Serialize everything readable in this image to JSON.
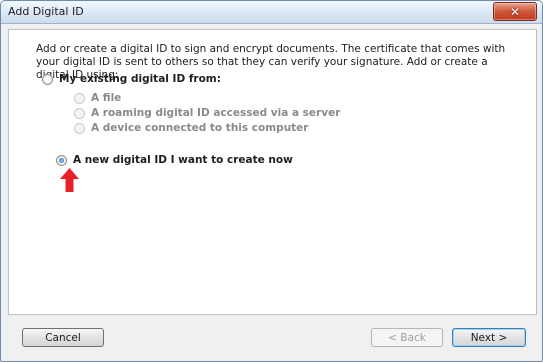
{
  "window": {
    "title": "Add Digital ID",
    "close_symbol": "✕"
  },
  "intro_text": "Add or create a digital ID to sign and encrypt documents. The certificate that comes with your digital ID is sent to others so that they can verify your signature. Add or create a digital ID using:",
  "options": {
    "existing": {
      "label": "My existing digital ID from:",
      "checked": false
    },
    "sub_options": [
      {
        "label": "A file",
        "enabled": false
      },
      {
        "label": "A roaming digital ID accessed via a server",
        "enabled": false
      },
      {
        "label": "A device connected to this computer",
        "enabled": false
      }
    ],
    "create_new": {
      "label": "A new digital ID I want to create now",
      "checked": true
    }
  },
  "annotation": {
    "icon": "red-arrow-up-icon",
    "color": "#e8202a"
  },
  "buttons": {
    "cancel": "Cancel",
    "back": "< Back",
    "next": "Next >"
  }
}
